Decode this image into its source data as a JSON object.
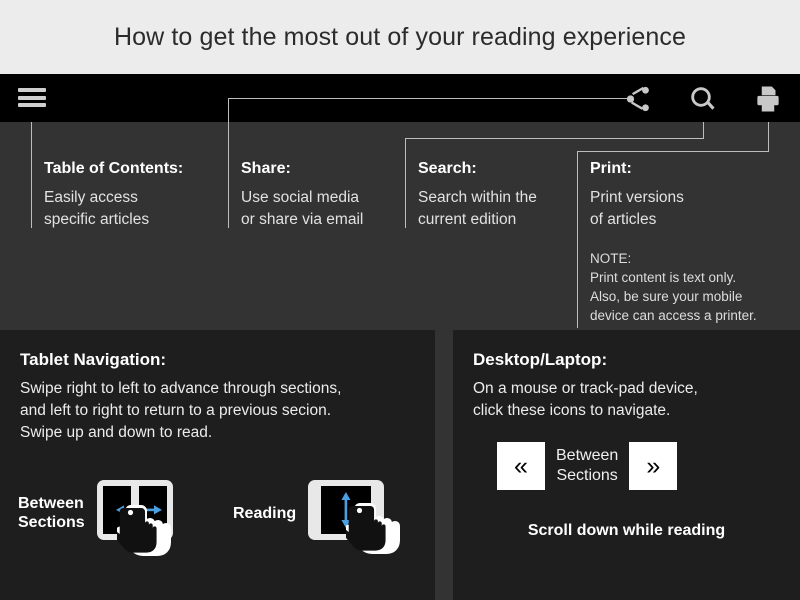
{
  "header": {
    "title": "How to get the most out of your reading experience",
    "bg_color": "#ececec",
    "text_color": "#2b2b2b"
  },
  "toolbar": {
    "bg_color": "#000000",
    "icon_color": "#c8c8c8",
    "menu_icon": "hamburger-menu-icon",
    "icons": [
      {
        "name": "share-icon",
        "label": "Share"
      },
      {
        "name": "search-icon",
        "label": "Search"
      },
      {
        "name": "print-icon",
        "label": "Print"
      }
    ]
  },
  "callouts": [
    {
      "id": "toc",
      "title": "Table of Contents:",
      "body": "Easily access\nspecific articles"
    },
    {
      "id": "share",
      "title": "Share:",
      "body": "Use social media\nor share via email"
    },
    {
      "id": "search",
      "title": "Search:",
      "body": "Search within the\ncurrent edition"
    },
    {
      "id": "print",
      "title": "Print:",
      "body": "Print versions\nof articles",
      "note": "NOTE:\nPrint content is text only.\nAlso, be sure your mobile\ndevice can access a printer."
    }
  ],
  "tablet_panel": {
    "title": "Tablet Navigation:",
    "body": "Swipe right to left to advance through sections,\nand left to right to return to a previous secion.\nSwipe up and down to read.",
    "gestures": [
      {
        "label": "Between\nSections",
        "icon": "tablet-swipe-horizontal-icon",
        "arrow": "horizontal-double-arrow",
        "arrow_color": "#4a9fe0"
      },
      {
        "label": "Reading",
        "icon": "tablet-swipe-vertical-icon",
        "arrow": "vertical-double-arrow",
        "arrow_color": "#4a9fe0"
      }
    ]
  },
  "desktop_panel": {
    "title": "Desktop/Laptop:",
    "body": "On a mouse or track-pad device,\nclick these icons to navigate.",
    "prev_button": "«",
    "next_button": "»",
    "between_label": "Between\nSections",
    "scroll_text": "Scroll down while reading"
  },
  "colors": {
    "page_bg": "#333333",
    "panel_bg": "#1e1e1e",
    "accent_blue": "#4a9fe0",
    "leader_line": "#bdbdbd"
  }
}
